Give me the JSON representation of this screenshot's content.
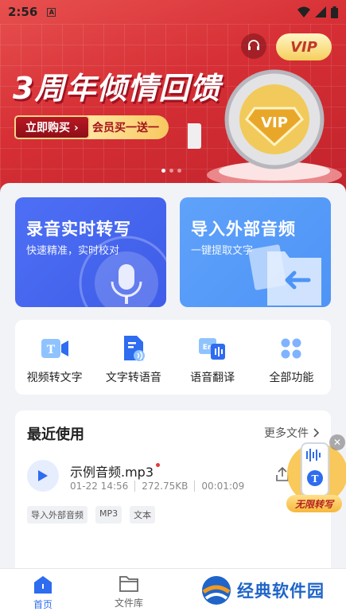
{
  "status_bar": {
    "time": "2:56",
    "notification_letter": "A"
  },
  "banner": {
    "title": "3周年倾情回馈",
    "buy_button": "立即购买 ›",
    "promo_text": "会员买一送一",
    "vip_badge": "VIP"
  },
  "cards": {
    "record": {
      "title": "录音实时转写",
      "subtitle": "快速精准，实时校对"
    },
    "import": {
      "title": "导入外部音频",
      "subtitle": "一键提取文字"
    }
  },
  "tools": [
    {
      "label": "视频转文字",
      "icon": "video-to-text-icon"
    },
    {
      "label": "文字转语音",
      "icon": "text-to-speech-icon"
    },
    {
      "label": "语音翻译",
      "icon": "voice-translate-icon"
    },
    {
      "label": "全部功能",
      "icon": "all-functions-icon"
    }
  ],
  "recent": {
    "title": "最近使用",
    "more_files": "更多文件",
    "file": {
      "name": "示例音频.mp3",
      "date": "01-22 14:56",
      "size": "272.75KB",
      "duration": "00:01:09",
      "tags": [
        "导入外部音频",
        "MP3",
        "文本"
      ]
    }
  },
  "float_promo": {
    "label": "无限转写"
  },
  "bottom_nav": {
    "items": [
      {
        "label": "首页",
        "active": true
      },
      {
        "label": "文件库",
        "active": false
      }
    ]
  },
  "watermark": {
    "text": "经典软件园"
  },
  "colors": {
    "primary": "#2e6cf0",
    "banner_red": "#d62f35",
    "card_blue": "#4d6ff5",
    "card_light_blue": "#5fa2fb"
  }
}
